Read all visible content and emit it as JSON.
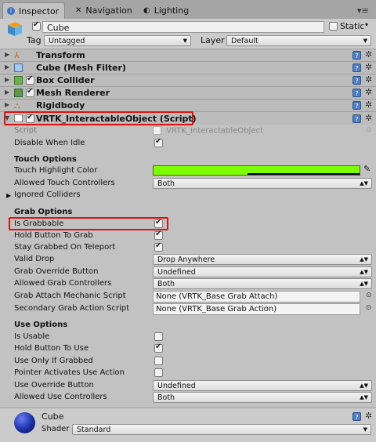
{
  "tabs": [
    {
      "label": "Inspector",
      "icon": "info-icon"
    },
    {
      "label": "Navigation",
      "icon": "navigation-icon"
    },
    {
      "label": "Lighting",
      "icon": "lighting-icon"
    }
  ],
  "header": {
    "name": "Cube",
    "static_label": "Static",
    "tag_label": "Tag",
    "tag_value": "Untagged",
    "layer_label": "Layer",
    "layer_value": "Default"
  },
  "components": [
    {
      "name": "Transform",
      "has_checkbox": false,
      "checked": false,
      "icon": "transform-icon"
    },
    {
      "name": "Cube (Mesh Filter)",
      "has_checkbox": false,
      "checked": false,
      "icon": "mesh-filter-icon"
    },
    {
      "name": "Box Collider",
      "has_checkbox": true,
      "checked": true,
      "icon": "box-collider-icon"
    },
    {
      "name": "Mesh Renderer",
      "has_checkbox": true,
      "checked": true,
      "icon": "mesh-renderer-icon"
    },
    {
      "name": "Rigidbody",
      "has_checkbox": false,
      "checked": false,
      "icon": "rigidbody-icon"
    },
    {
      "name": "VRTK_InteractableObject (Script)",
      "has_checkbox": true,
      "checked": true,
      "icon": "script-icon"
    }
  ],
  "script": {
    "script_label": "Script",
    "script_value": "VRTK_InteractableObject",
    "disable_when_idle_label": "Disable When Idle",
    "disable_when_idle": true
  },
  "touch": {
    "section": "Touch Options",
    "highlight_label": "Touch Highlight Color",
    "highlight_color": "#7cff00",
    "allowed_label": "Allowed Touch Controllers",
    "allowed_value": "Both",
    "ignored_label": "Ignored Colliders"
  },
  "grab": {
    "section": "Grab Options",
    "is_grabbable_label": "Is Grabbable",
    "is_grabbable": true,
    "hold_label": "Hold Button To Grab",
    "hold": true,
    "stay_label": "Stay Grabbed On Teleport",
    "stay": true,
    "valid_drop_label": "Valid Drop",
    "valid_drop_value": "Drop Anywhere",
    "override_label": "Grab Override Button",
    "override_value": "Undefined",
    "allowed_label": "Allowed Grab Controllers",
    "allowed_value": "Both",
    "attach_label": "Grab Attach Mechanic Script",
    "attach_value": "None (VRTK_Base Grab Attach)",
    "secondary_label": "Secondary Grab Action Script",
    "secondary_value": "None (VRTK_Base Grab Action)"
  },
  "use": {
    "section": "Use Options",
    "is_usable_label": "Is Usable",
    "is_usable": false,
    "hold_label": "Hold Button To Use",
    "hold": true,
    "only_grabbed_label": "Use Only If Grabbed",
    "only_grabbed": false,
    "pointer_label": "Pointer Activates Use Action",
    "pointer": false,
    "override_label": "Use Override Button",
    "override_value": "Undefined",
    "allowed_label": "Allowed Use Controllers",
    "allowed_value": "Both"
  },
  "material": {
    "name": "Cube",
    "shader_label": "Shader",
    "shader_value": "Standard"
  },
  "colors": {
    "highlight_box": "#e01010",
    "sphere": "#1a2fa8"
  }
}
